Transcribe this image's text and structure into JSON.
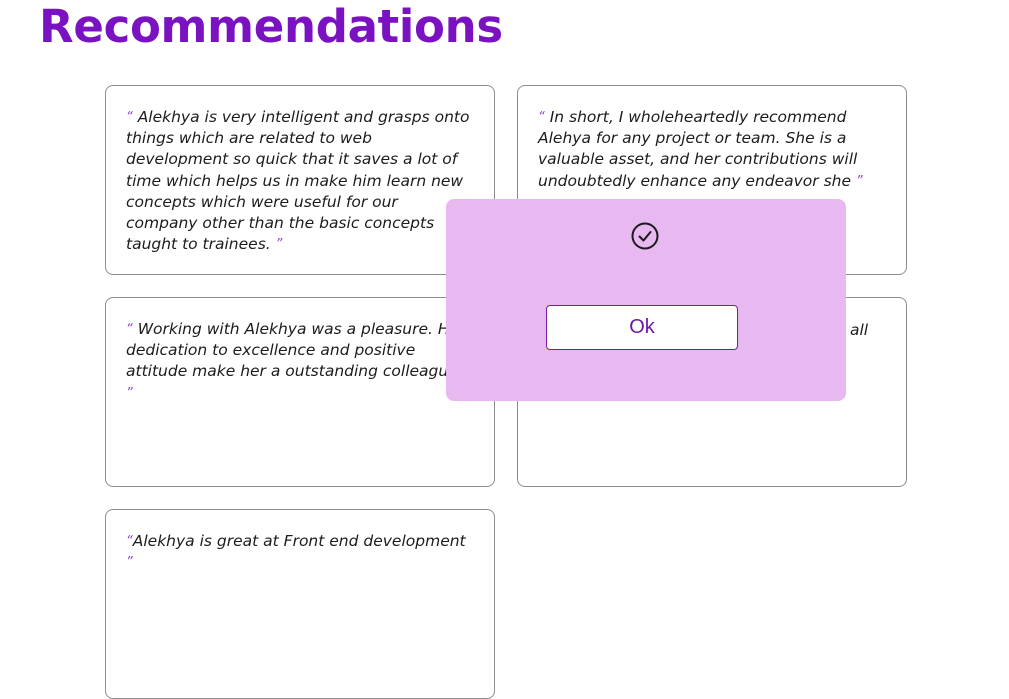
{
  "page": {
    "title": "Recommendations"
  },
  "recommendations": [
    {
      "open_quote": "“",
      "text": "Alekhya is very intelligent and grasps onto things which are related to web development so quick that it saves a lot of time which helps us in make him learn new concepts which were useful for our company other than the basic concepts taught to trainees.",
      "close_quote": "”"
    },
    {
      "open_quote": "“",
      "text": "In short, I wholeheartedly recommend Alehya for any project or team. She is a valuable asset, and her contributions will undoubtedly enhance any endeavor she",
      "close_quote": "”"
    },
    {
      "open_quote": "“",
      "text": "Working with Alekhya was a pleasure. Her dedication to excellence and positive attitude make her a outstanding colleague.",
      "close_quote": "”"
    },
    {
      "visible_fragment_line1": "s all",
      "close_quote": "”"
    },
    {
      "open_quote": "“",
      "text": "Alekhya is great at Front end development",
      "close_quote": "”"
    }
  ],
  "modal": {
    "icon": "check-circle-icon",
    "ok_label": "Ok"
  },
  "colors": {
    "title": "#7a12c1",
    "modal_background": "#e8b9f0",
    "button_border": "#7a1aa8",
    "button_text": "#6a1aa0",
    "quote_mark": "#8d3fd0"
  }
}
